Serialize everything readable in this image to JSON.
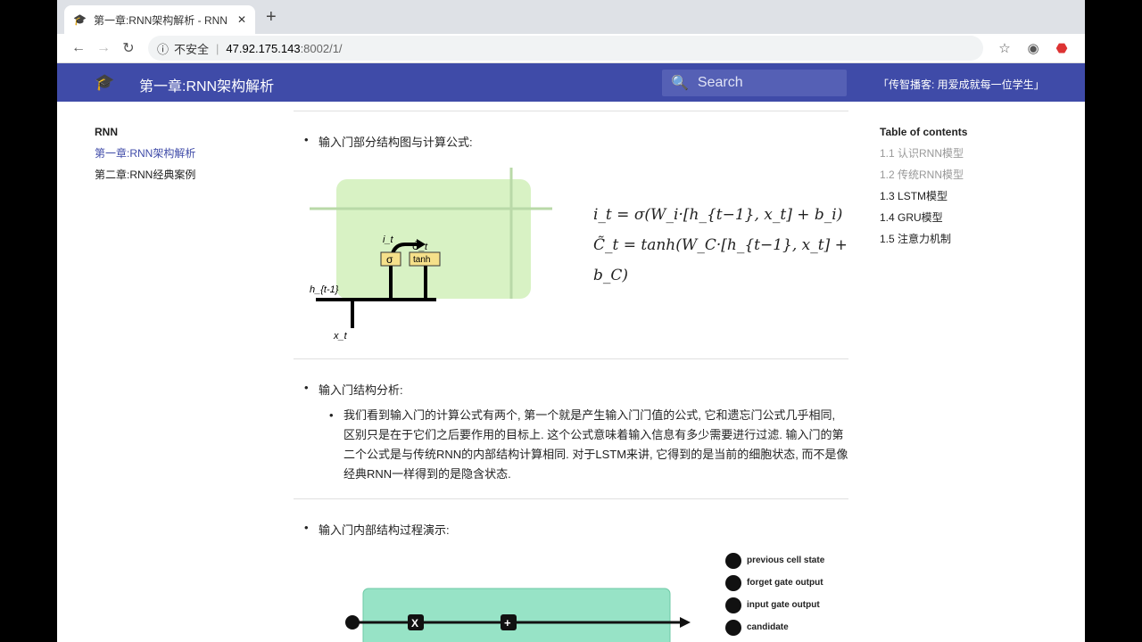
{
  "browser": {
    "tab_title": "第一章:RNN架构解析 - RNN",
    "security": "不安全",
    "url_host": "47.92.175.143",
    "url_path": ":8002/1/"
  },
  "header": {
    "title": "第一章:RNN架构解析",
    "search_placeholder": "Search",
    "slogan": "「传智播客: 用爱成就每一位学生」",
    "color": "#3f4ba8"
  },
  "sidebar": {
    "heading": "RNN",
    "items": [
      {
        "label": "第一章:RNN架构解析",
        "active": true
      },
      {
        "label": "第二章:RNN经典案例",
        "active": false
      }
    ]
  },
  "toc": {
    "heading": "Table of contents",
    "items": [
      "1.1 认识RNN模型",
      "1.2 传统RNN模型",
      "1.3 LSTM模型",
      "1.4 GRU模型",
      "1.5 注意力机制"
    ]
  },
  "content": {
    "section1": "输入门部分结构图与计算公式:",
    "diagram1": {
      "labels": [
        "σ",
        "tanh",
        "h_{t-1}",
        "x_t",
        "i_t",
        "C̃_t"
      ]
    },
    "formula1": "i_t = σ(W_i·[h_{t−1}, x_t] + b_i)",
    "formula2": "C̃_t = tanh(W_C·[h_{t−1}, x_t] + b_C)",
    "section2": "输入门结构分析:",
    "analysis": "我们看到输入门的计算公式有两个, 第一个就是产生输入门门值的公式, 它和遗忘门公式几乎相同, 区别只是在于它们之后要作用的目标上. 这个公式意味着输入信息有多少需要进行过滤. 输入门的第二个公式是与传统RNN的内部结构计算相同. 对于LSTM来讲, 它得到的是当前的细胞状态, 而不是像经典RNN一样得到的是隐含状态.",
    "section3": "输入门内部结构过程演示:",
    "legend": [
      "previous cell state",
      "forget gate output",
      "input gate output",
      "candidate"
    ],
    "ops": [
      "X",
      "+"
    ]
  }
}
